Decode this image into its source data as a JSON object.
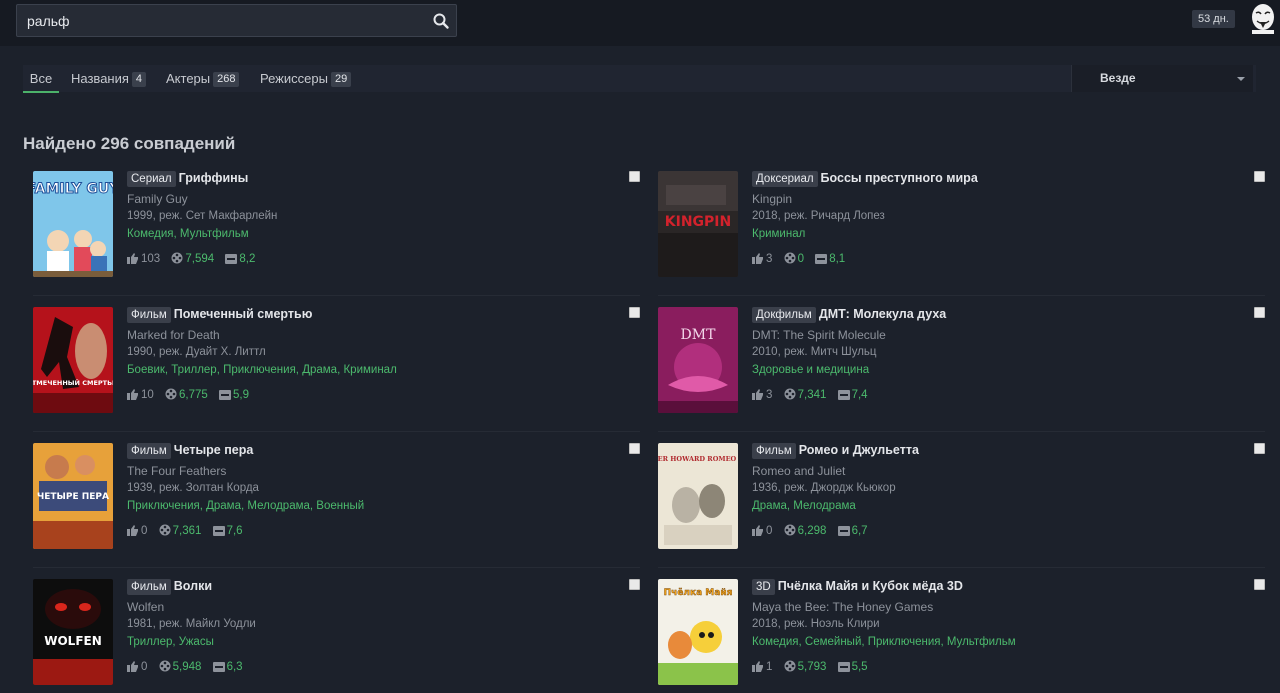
{
  "search": {
    "value": "ральф"
  },
  "header": {
    "days_badge": "53 дн."
  },
  "tabs": [
    {
      "label": "Все",
      "count": ""
    },
    {
      "label": "Названия",
      "count": "4"
    },
    {
      "label": "Актеры",
      "count": "268"
    },
    {
      "label": "Режиссеры",
      "count": "29"
    }
  ],
  "filter": {
    "selected": "Везде"
  },
  "results_title": "Найдено 296 совпадений",
  "results": [
    {
      "type": "Сериал",
      "title": "Гриффины",
      "orig": "Family Guy",
      "meta": "1999, реж. Сет Макфарлейн",
      "genres": "Комедия, Мультфильм",
      "likes": "103",
      "views": "7,594",
      "rating": "8,2"
    },
    {
      "type": "Доксериал",
      "title": "Боссы преступного мира",
      "orig": "Kingpin",
      "meta": "2018, реж. Ричард Лопез",
      "genres": "Криминал",
      "likes": "3",
      "views": "0",
      "rating": "8,1"
    },
    {
      "type": "Фильм",
      "title": "Помеченный смертью",
      "orig": "Marked for Death",
      "meta": "1990, реж. Дуайт Х. Литтл",
      "genres": "Боевик, Триллер, Приключения, Драма, Криминал",
      "likes": "10",
      "views": "6,775",
      "rating": "5,9"
    },
    {
      "type": "Докфильм",
      "title": "ДМТ: Молекула духа",
      "orig": "DMT: The Spirit Molecule",
      "meta": "2010, реж. Митч Шульц",
      "genres": "Здоровье и медицина",
      "likes": "3",
      "views": "7,341",
      "rating": "7,4"
    },
    {
      "type": "Фильм",
      "title": "Четыре пера",
      "orig": "The Four Feathers",
      "meta": "1939, реж. Золтан Корда",
      "genres": "Приключения, Драма, Мелодрама, Военный",
      "likes": "0",
      "views": "7,361",
      "rating": "7,6"
    },
    {
      "type": "Фильм",
      "title": "Ромео и Джульетта",
      "orig": "Romeo and Juliet",
      "meta": "1936, реж. Джордж Кьюкор",
      "genres": "Драма, Мелодрама",
      "likes": "0",
      "views": "6,298",
      "rating": "6,7"
    },
    {
      "type": "Фильм",
      "title": "Волки",
      "orig": "Wolfen",
      "meta": "1981, реж. Майкл Уодли",
      "genres": "Триллер, Ужасы",
      "likes": "0",
      "views": "5,948",
      "rating": "6,3"
    },
    {
      "type": "3D",
      "title": "Пчёлка Майя и Кубок мёда 3D",
      "orig": "Maya the Bee: The Honey Games",
      "meta": "2018, реж. Ноэль Клири",
      "genres": "Комедия, Семейный, Приключения, Мультфильм",
      "likes": "1",
      "views": "5,793",
      "rating": "5,5"
    }
  ],
  "poster_text": {
    "p0": "FAMILY GUY",
    "p1": "KINGPIN",
    "p2": "ОТМЕЧЕННЫЙ СМЕРТЬЮ",
    "p3": "DMT",
    "p4": "ЧЕТЫРЕ ПЕРА",
    "p5": "SHEARER HOWARD ROMEO JULIET",
    "p6": "WOLFEN",
    "p7": "Пчёлка Майя"
  },
  "colors": {
    "accent": "#4cba6d",
    "background": "#1c212b",
    "topbar": "#161a22"
  }
}
